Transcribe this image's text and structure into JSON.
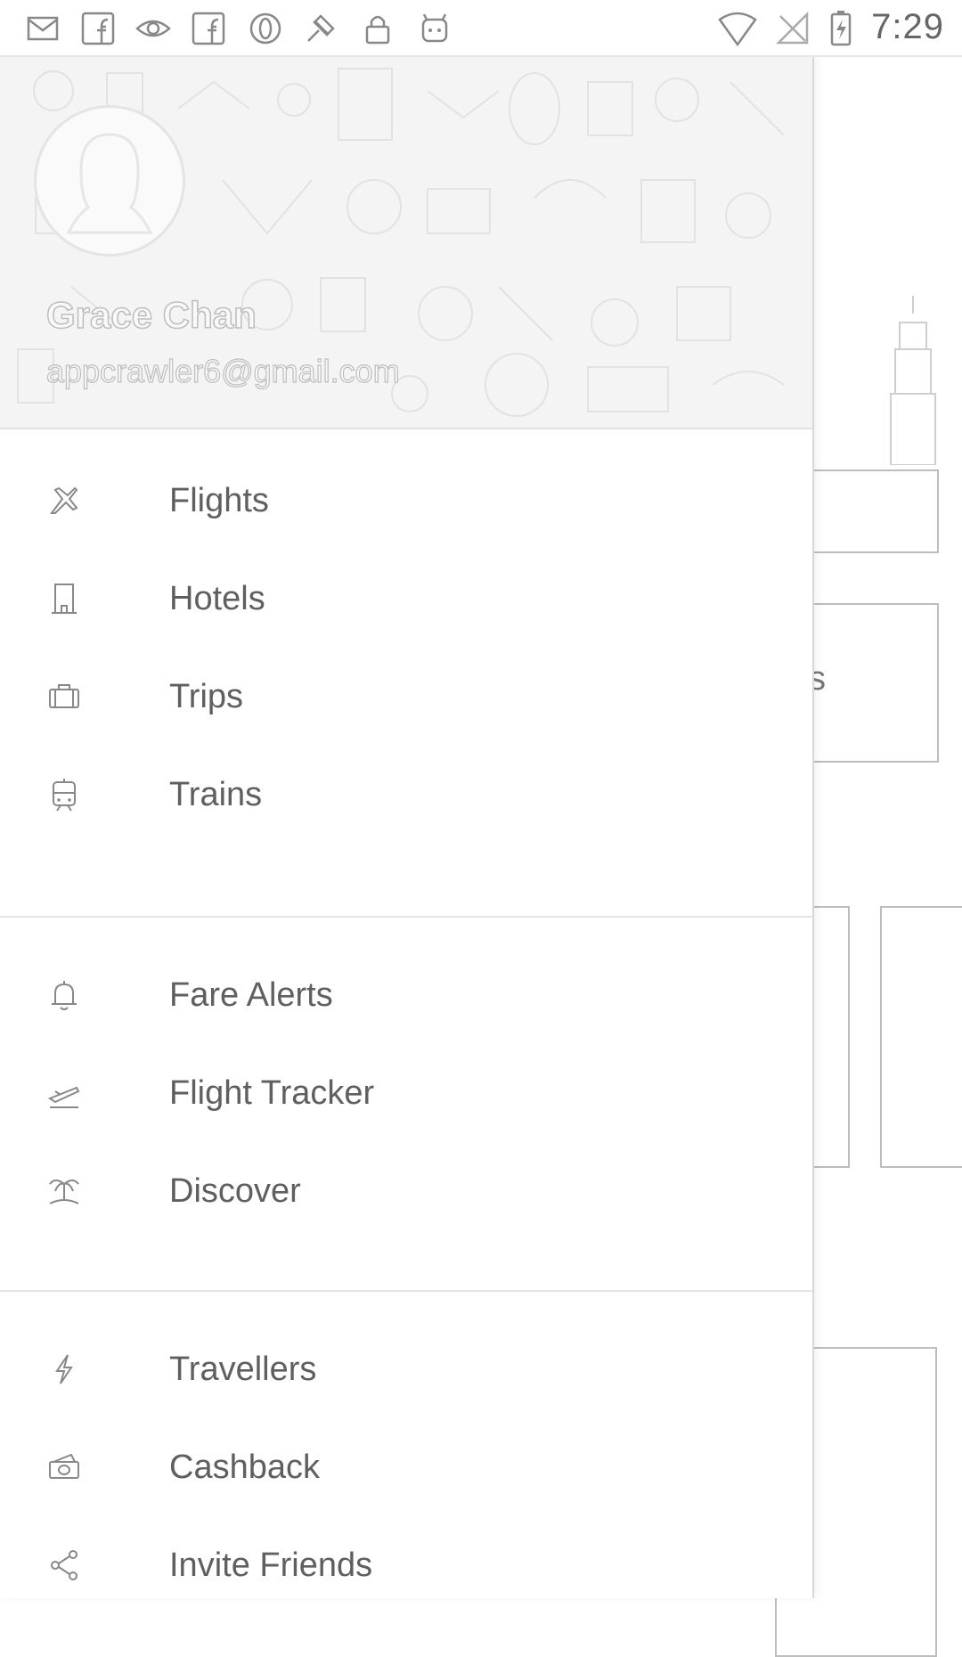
{
  "status_bar": {
    "time": "7:29",
    "left_icons": [
      "email-icon",
      "facebook-icon",
      "eye-icon",
      "facebook-icon",
      "opera-icon",
      "satellite-icon",
      "lock-icon",
      "android-icon"
    ],
    "right_icons": [
      "wifi-icon",
      "no-signal-icon",
      "battery-charging-icon"
    ]
  },
  "drawer": {
    "user": {
      "name": "Grace Chan",
      "email": "appcrawler6@gmail.com"
    },
    "sections": [
      [
        {
          "label": "Flights",
          "icon": "airplane-icon"
        },
        {
          "label": "Hotels",
          "icon": "hotel-icon"
        },
        {
          "label": "Trips",
          "icon": "suitcase-icon"
        },
        {
          "label": "Trains",
          "icon": "train-icon"
        }
      ],
      [
        {
          "label": "Fare Alerts",
          "icon": "bell-icon"
        },
        {
          "label": "Flight Tracker",
          "icon": "flight-takeoff-icon"
        },
        {
          "label": "Discover",
          "icon": "palm-tree-icon"
        }
      ],
      [
        {
          "label": "Travellers",
          "icon": "lightning-icon"
        },
        {
          "label": "Cashback",
          "icon": "cash-icon"
        },
        {
          "label": "Invite Friends",
          "icon": "share-icon"
        }
      ]
    ]
  },
  "background": {
    "partial_text": "s"
  }
}
